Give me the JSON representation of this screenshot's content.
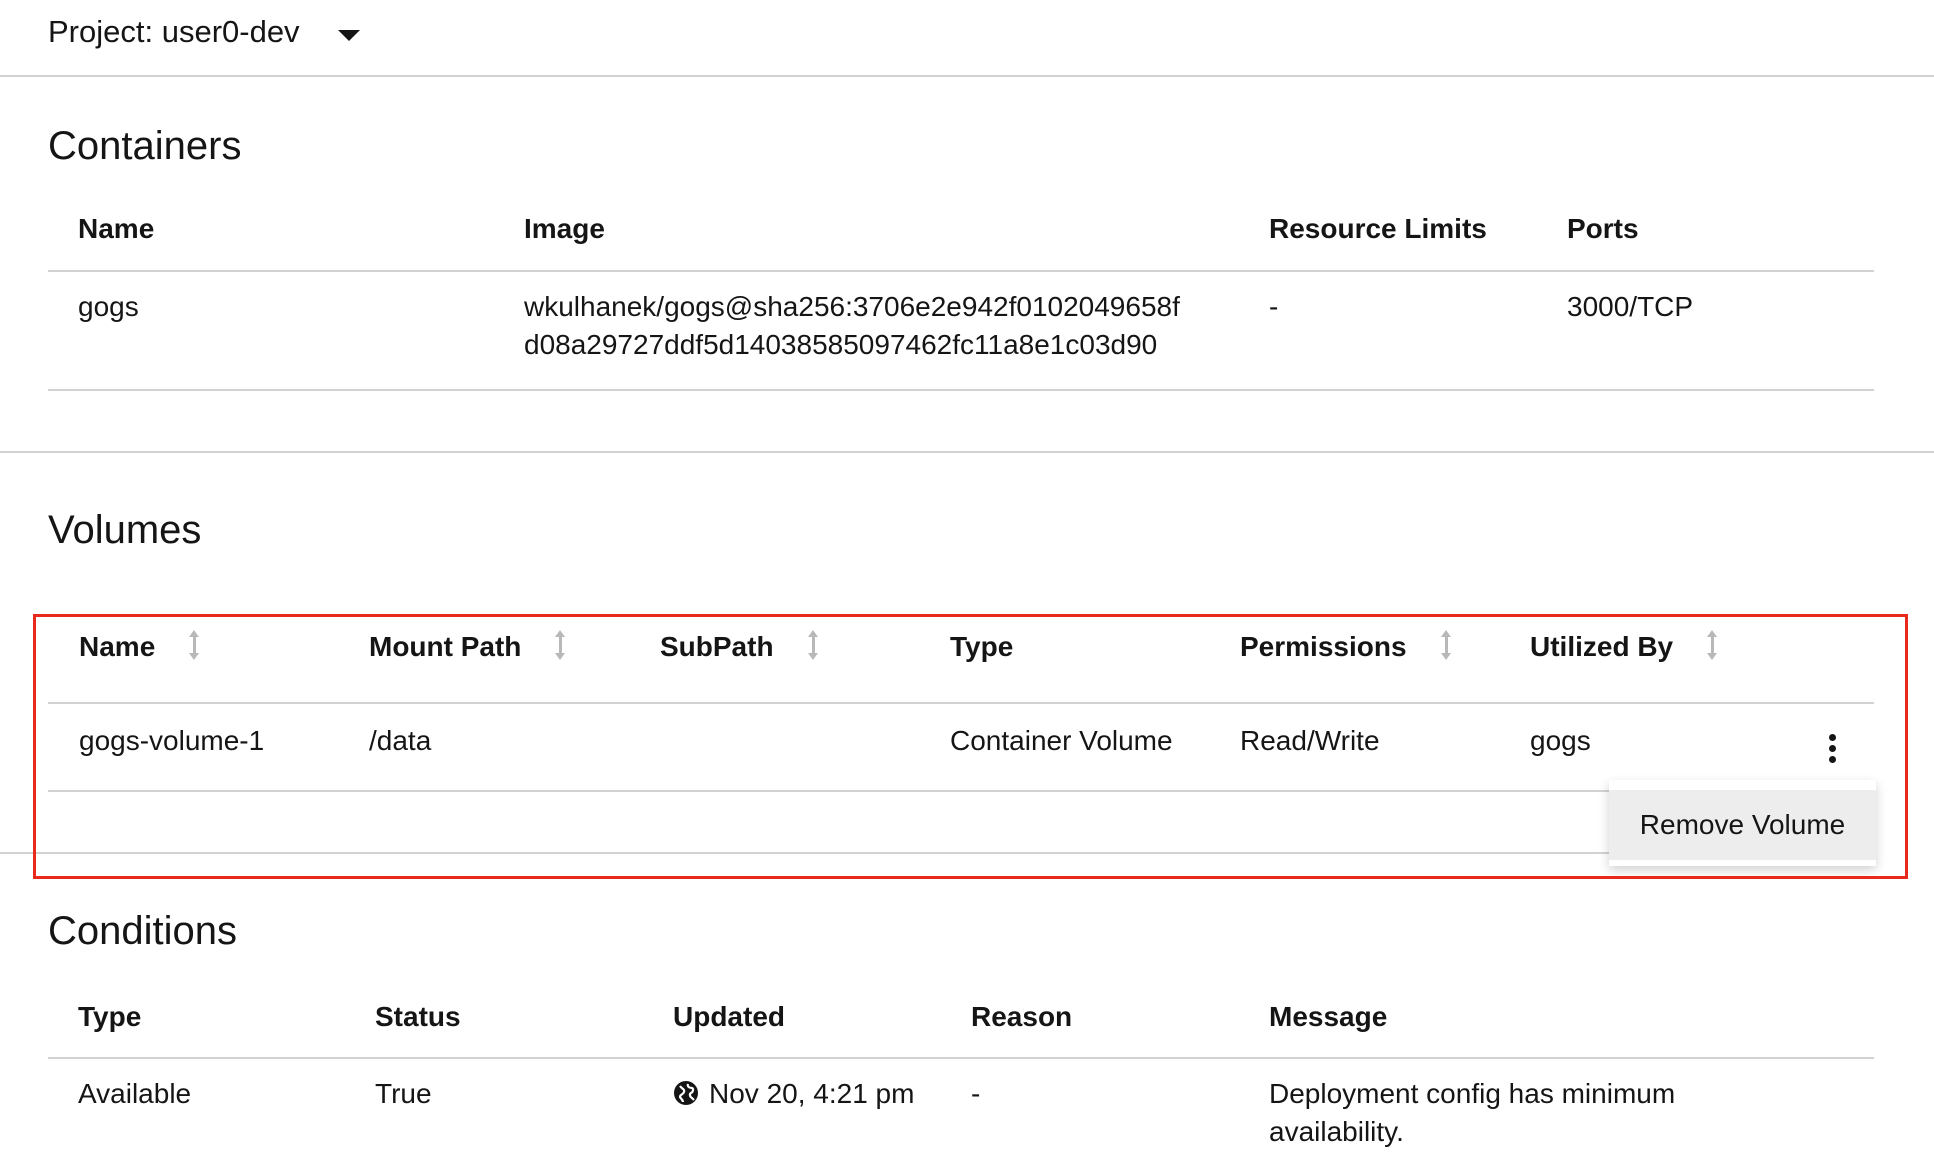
{
  "project": {
    "label": "Project: user0-dev"
  },
  "containers": {
    "title": "Containers",
    "columns": [
      "Name",
      "Image",
      "Resource Limits",
      "Ports"
    ],
    "rows": [
      {
        "name": "gogs",
        "image_line1": "wkulhanek/gogs@sha256:3706e2e942f0102049658f",
        "image_line2": "d08a29727ddf5d14038585097462fc11a8e1c03d90",
        "resource_limits": "-",
        "ports": "3000/TCP"
      }
    ]
  },
  "volumes": {
    "title": "Volumes",
    "columns": [
      "Name",
      "Mount Path",
      "SubPath",
      "Type",
      "Permissions",
      "Utilized By"
    ],
    "rows": [
      {
        "name": "gogs-volume-1",
        "mount_path": "/data",
        "subpath": "",
        "type": "Container Volume",
        "permissions": "Read/Write",
        "utilized_by": "gogs"
      }
    ],
    "menu": {
      "remove_label": "Remove Volume"
    }
  },
  "conditions": {
    "title": "Conditions",
    "columns": [
      "Type",
      "Status",
      "Updated",
      "Reason",
      "Message"
    ],
    "rows": [
      {
        "type": "Available",
        "status": "True",
        "updated": "Nov 20, 4:21 pm",
        "reason": "-",
        "message_line1": "Deployment config has minimum",
        "message_line2": "availability."
      }
    ]
  },
  "icons": {
    "caret": "caret-down-icon",
    "sort": "sort-icon",
    "kebab": "kebab-icon",
    "globe": "globe-icon"
  },
  "colors": {
    "highlight": "#e8291c",
    "divider": "#d2d2d2",
    "menu_item_bg": "#ededed"
  }
}
